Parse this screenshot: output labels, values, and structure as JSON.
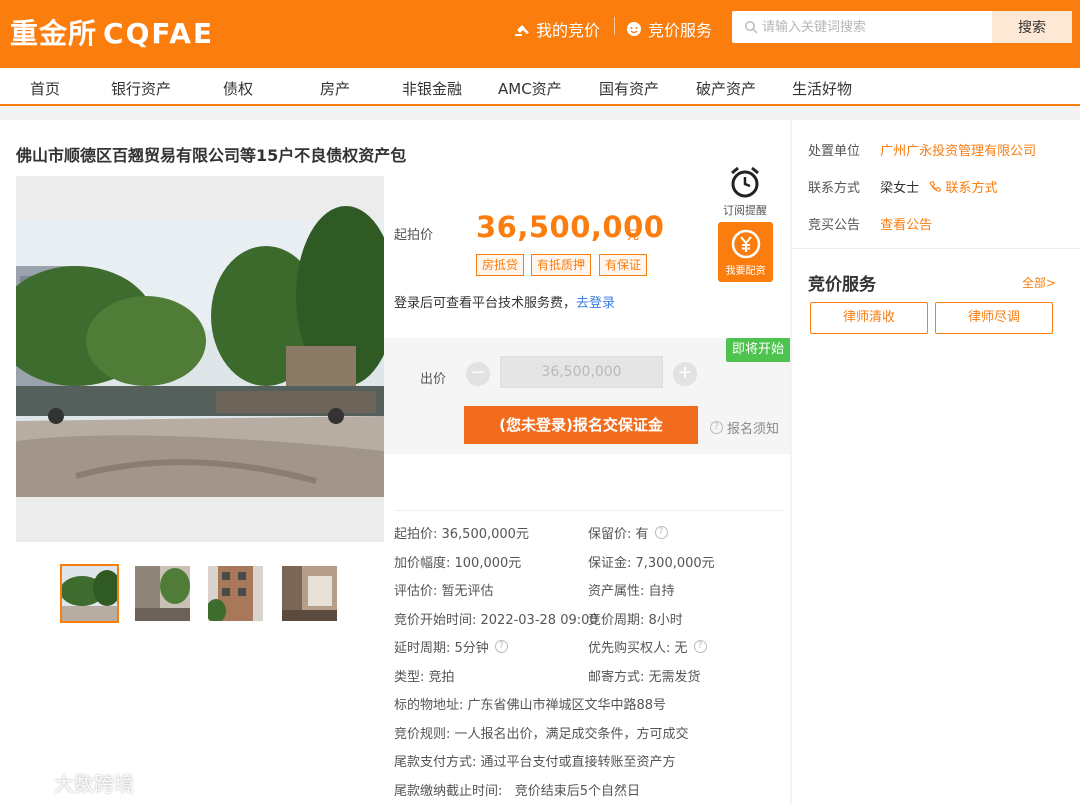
{
  "header": {
    "logo_cn": "重金所",
    "logo_en": "CQFAE",
    "my_bids": "我的竞价",
    "bid_service": "竞价服务",
    "search_placeholder": "请输入关键词搜索",
    "search_button": "搜索",
    "brand_color": "#fa7d0e"
  },
  "nav": {
    "items": [
      "首页",
      "银行资产",
      "债权",
      "房产",
      "非银金融",
      "AMC资产",
      "国有资产",
      "破产资产",
      "生活好物"
    ]
  },
  "listing": {
    "title": "佛山市顺德区百翘贸易有限公司等15户不良债权资产包",
    "price_label": "起拍价",
    "price": "36,500,000",
    "price_unit": "元",
    "tags": [
      "房抵贷",
      "有抵质押",
      "有保证"
    ],
    "login_tip": "登录后可查看平台技术服务费，",
    "login_link": "去登录",
    "remind_label": "订阅提醒",
    "signup_label": "我要配资",
    "status_badge": "即将开始",
    "bid_label": "出价",
    "bid_value": "36,500,000",
    "minus_symbol": "−",
    "plus_symbol": "+",
    "enroll_button": "(您未登录)报名交保证金",
    "notice_link": "报名须知",
    "thumbnail_count": 4
  },
  "details": {
    "start_price": "起拍价: 36,500,000元",
    "reserve_price": "保留价: 有",
    "increment": "加价幅度: 100,000元",
    "deposit": "保证金: 7,300,000元",
    "valuation": "评估价: 暂无评估",
    "asset_attr": "资产属性: 自持",
    "start_time": "竞价开始时间: 2022-03-28 09:00",
    "period": "竞价周期: 8小时",
    "extension": "延时周期: 5分钟",
    "priority": "优先购买权人: 无",
    "type": "类型: 竞拍",
    "mail": "邮寄方式: 无需发货",
    "address": "标的物地址: 广东省佛山市禅城区文华中路88号",
    "rule": "竞价规则: 一人报名出价，满足成交条件，方可成交",
    "payment": "尾款支付方式: 通过平台支付或直接转账至资产方",
    "deadline": "尾款缴纳截止时间:   竞价结束后5个自然日"
  },
  "side": {
    "org_label": "处置单位",
    "org_value": "广州广永投资管理有限公司",
    "contact_label": "联系方式",
    "contact_name": "梁女士",
    "contact_link": "联系方式",
    "notice_label": "竞买公告",
    "notice_link": "查看公告",
    "service_title": "竞价服务",
    "more": "全部>",
    "btn_lawyer_clear": "律师清收",
    "btn_lawyer_dd": "律师尽调"
  },
  "watermark": "大数跨境"
}
